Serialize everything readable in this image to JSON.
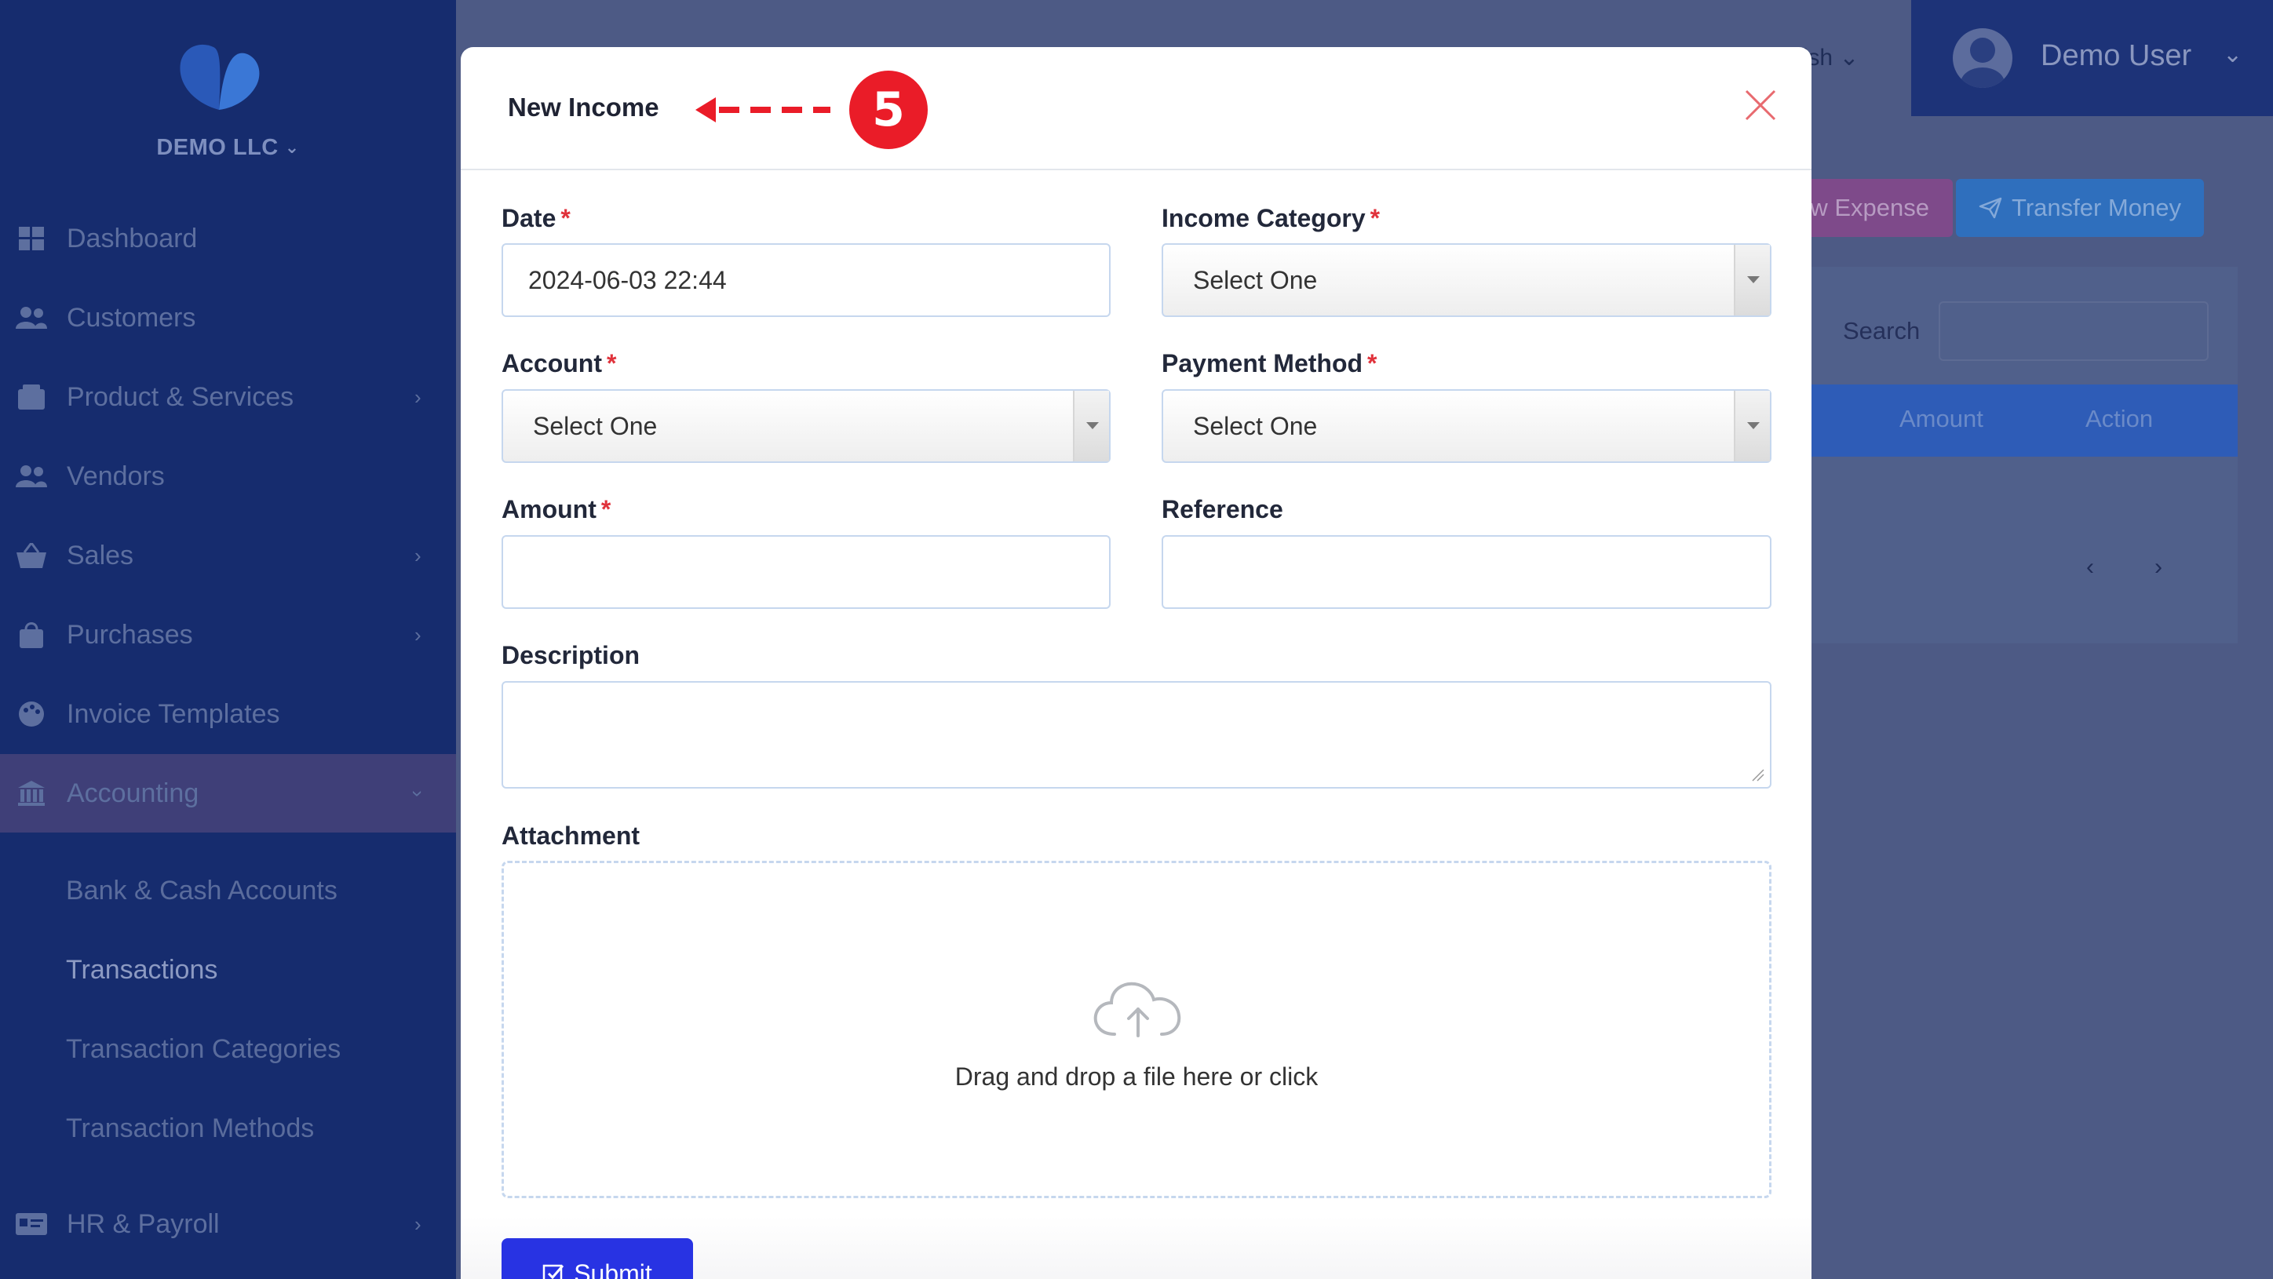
{
  "sidebar": {
    "company": "DEMO LLC",
    "items": [
      {
        "label": "Dashboard",
        "icon": "dashboard-icon"
      },
      {
        "label": "Customers",
        "icon": "users-icon"
      },
      {
        "label": "Product & Services",
        "icon": "box-icon"
      },
      {
        "label": "Vendors",
        "icon": "users-icon"
      },
      {
        "label": "Sales",
        "icon": "basket-icon"
      },
      {
        "label": "Purchases",
        "icon": "bag-icon"
      },
      {
        "label": "Invoice Templates",
        "icon": "palette-icon"
      },
      {
        "label": "Accounting",
        "icon": "bank-icon"
      },
      {
        "label": "HR & Payroll",
        "icon": "id-card-icon"
      }
    ],
    "accounting_sub": [
      "Bank & Cash Accounts",
      "Transactions",
      "Transaction Categories",
      "Transaction Methods"
    ]
  },
  "topbar": {
    "language": "lish",
    "user_name": "Demo User"
  },
  "background": {
    "expense_btn": "w Expense",
    "transfer_btn": "Transfer Money",
    "search_label": "Search",
    "col_amount": "Amount",
    "col_action": "Action"
  },
  "modal": {
    "title": "New Income",
    "step_badge": "5",
    "fields": {
      "date_label": "Date",
      "date_value": "2024-06-03 22:44",
      "category_label": "Income Category",
      "category_value": "Select One",
      "account_label": "Account",
      "account_value": "Select One",
      "method_label": "Payment Method",
      "method_value": "Select One",
      "amount_label": "Amount",
      "amount_value": "",
      "reference_label": "Reference",
      "reference_value": "",
      "description_label": "Description",
      "attachment_label": "Attachment",
      "dropzone_text": "Drag and drop a file here or click"
    },
    "submit_label": "Submit"
  },
  "colors": {
    "sidebar_bg": "#162c6e",
    "overlay_bg": "#4d5a85",
    "submit": "#2833e3",
    "required": "#e0323b",
    "badge": "#ea1c28"
  }
}
